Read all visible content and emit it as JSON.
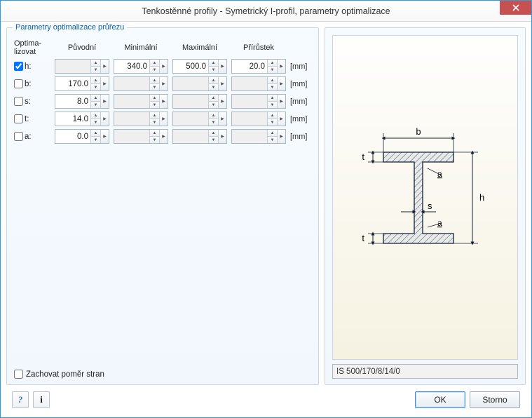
{
  "window": {
    "title": "Tenkostěnné profily - Symetrický I-profil, parametry optimalizace"
  },
  "group": {
    "label": "Parametry optimalizace průřezu"
  },
  "headers": {
    "opt1": "Optima-",
    "opt2": "lizovat",
    "orig": "Původní",
    "min": "Minimální",
    "max": "Maximální",
    "inc": "Přírůstek"
  },
  "unit": "[mm]",
  "rows": {
    "h": {
      "label": "h:",
      "checked": true,
      "orig": "",
      "min": "340.0",
      "max": "500.0",
      "inc": "20.0"
    },
    "b": {
      "label": "b:",
      "checked": false,
      "orig": "170.0",
      "min": "",
      "max": "",
      "inc": ""
    },
    "s": {
      "label": "s:",
      "checked": false,
      "orig": "8.0",
      "min": "",
      "max": "",
      "inc": ""
    },
    "t": {
      "label": "t:",
      "checked": false,
      "orig": "14.0",
      "min": "",
      "max": "",
      "inc": ""
    },
    "a": {
      "label": "a:",
      "checked": false,
      "orig": "0.0",
      "min": "",
      "max": "",
      "inc": ""
    }
  },
  "preserve": {
    "label": "Zachovat poměr stran",
    "checked": false
  },
  "designation": "IS 500/170/8/14/0",
  "diagram_labels": {
    "b": "b",
    "t": "t",
    "a": "a",
    "s": "s",
    "h": "h"
  },
  "buttons": {
    "ok": "OK",
    "cancel": "Storno"
  },
  "icons": {
    "help": "?",
    "info": "i"
  }
}
